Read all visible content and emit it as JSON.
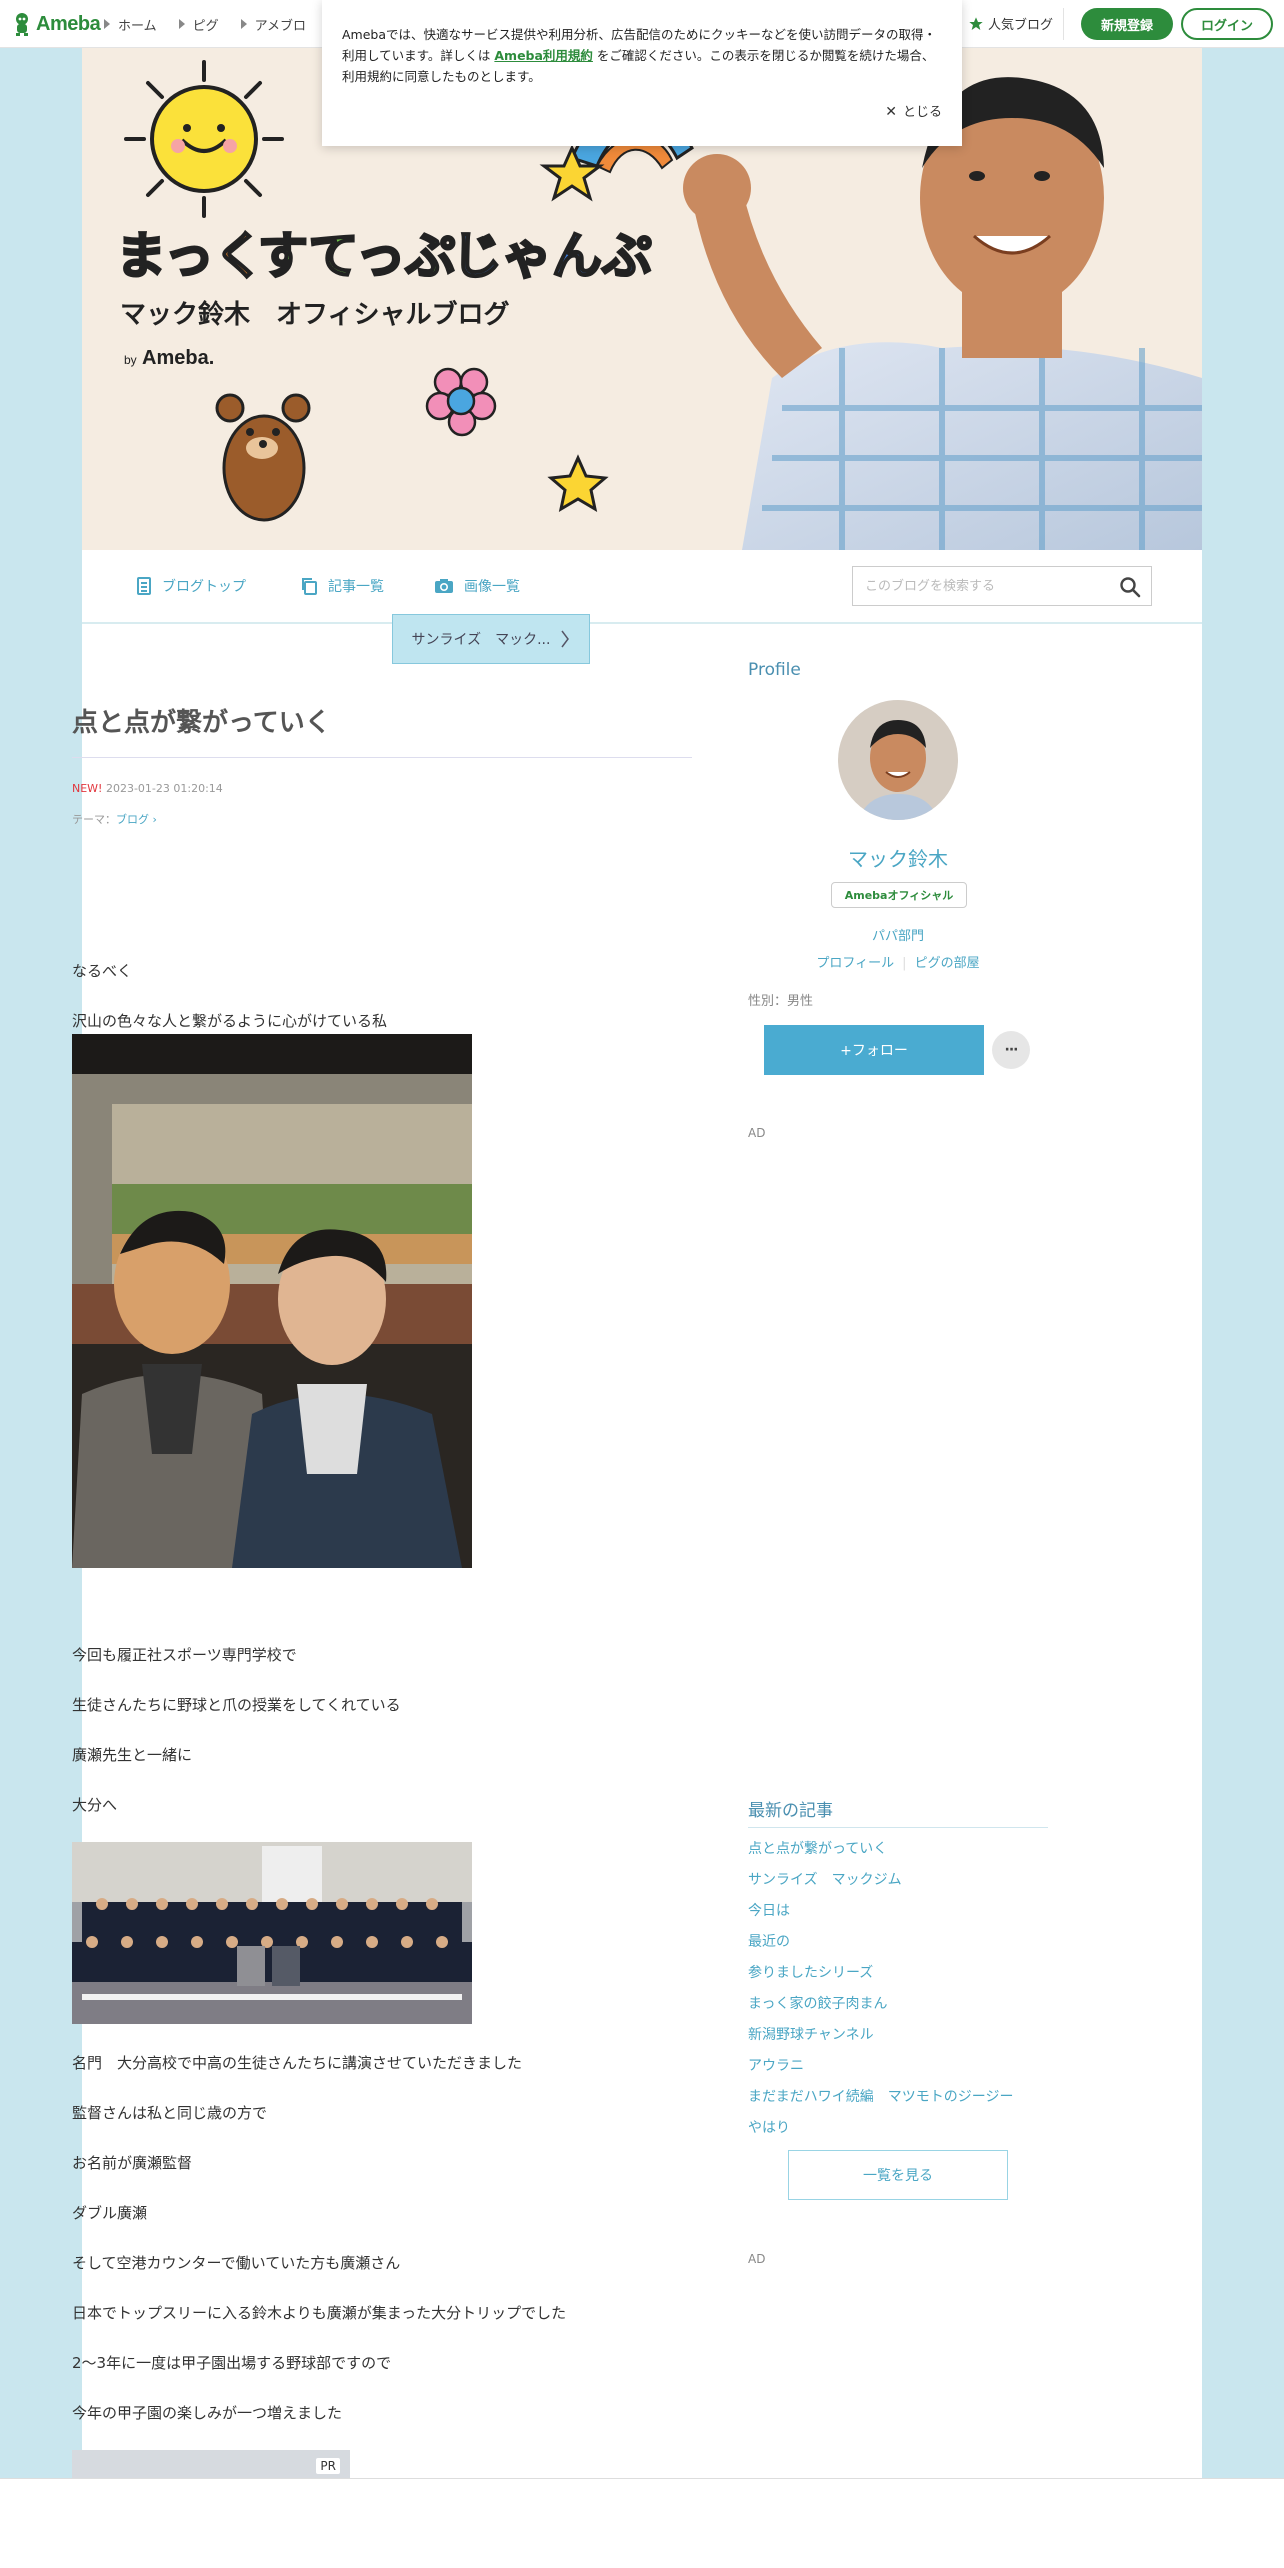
{
  "topbar": {
    "logo_text": "Ameba",
    "nav": [
      "ホーム",
      "ピグ",
      "アメブロ"
    ],
    "popular_label": "人気ブログ",
    "register_label": "新規登録",
    "login_label": "ログイン"
  },
  "cookie": {
    "text_before": "Amebaでは、快適なサービス提供や利用分析、広告配信のためにクッキーなどを使い訪問データの取得・利用しています。詳しくは",
    "link": "Ameba利用規約",
    "text_after": "をご確認ください。この表示を閉じるか閲覧を続けた場合、利用規約に同意したものとします。",
    "close_label": "とじる"
  },
  "header": {
    "title_1": "まっく",
    "title_2": "すてっぷ",
    "title_3": "じゃんぷ",
    "subtitle": "マック鈴木　オフィシャルブログ",
    "by": "by",
    "by_brand": "Ameba."
  },
  "blognav": {
    "items": [
      "ブログトップ",
      "記事一覧",
      "画像一覧"
    ],
    "search_placeholder": "このブログを検索する"
  },
  "article": {
    "series_label": "サンライズ　マック...",
    "title": "点と点が繋がっていく",
    "new_badge": "NEW!",
    "datetime": "2023-01-23 01:20:14",
    "theme_label": "テーマ：",
    "theme_value": "ブログ",
    "paragraphs_1": [
      "なるべく",
      "沢山の色々な人と繋がるように心がけている私"
    ],
    "paragraphs_2": [
      "今回も履正社スポーツ専門学校で",
      "生徒さんたちに野球と爪の授業をしてくれている",
      "廣瀬先生と一緒に",
      "大分へ"
    ],
    "paragraphs_3": [
      "名門　大分高校で中高の生徒さんたちに講演させていただきました",
      "監督さんは私と同じ歳の方で",
      "お名前が廣瀬監督",
      "ダブル廣瀬",
      "そして空港カウンターで働いていた方も廣瀬さん",
      "日本でトップスリーに入る鈴木よりも廣瀬が集まった大分トリップでした",
      "2〜3年に一度は甲子園出場する野球部ですので",
      "今年の甲子園の楽しみが一つ増えました"
    ],
    "pr_label": "PR"
  },
  "sidebar": {
    "profile_heading": "Profile",
    "name": "マック鈴木",
    "official_badge": "Amebaオフィシャル",
    "category": "パパ部門",
    "links": [
      "プロフィール",
      "ピグの部屋"
    ],
    "gender": "性別：男性",
    "follow_label": "+フォロー",
    "more_label": "···",
    "ad_label": "AD",
    "recent_heading": "最新の記事",
    "recent": [
      "点と点が繋がっていく",
      "サンライズ　マックジム",
      "今日は",
      "最近の",
      "参りましたシリーズ",
      "まっく家の餃子肉まん",
      "新潟野球チャンネル",
      "アウラニ",
      "まだまだハワイ続編　マツモトのジージー",
      "やはり"
    ],
    "list_button": "一覧を見る"
  },
  "colors": {
    "ameba_green": "#2d8c3c",
    "link_blue": "#4aa6c4",
    "follow_blue": "#4aabd1",
    "background": "#c9e6ee"
  }
}
